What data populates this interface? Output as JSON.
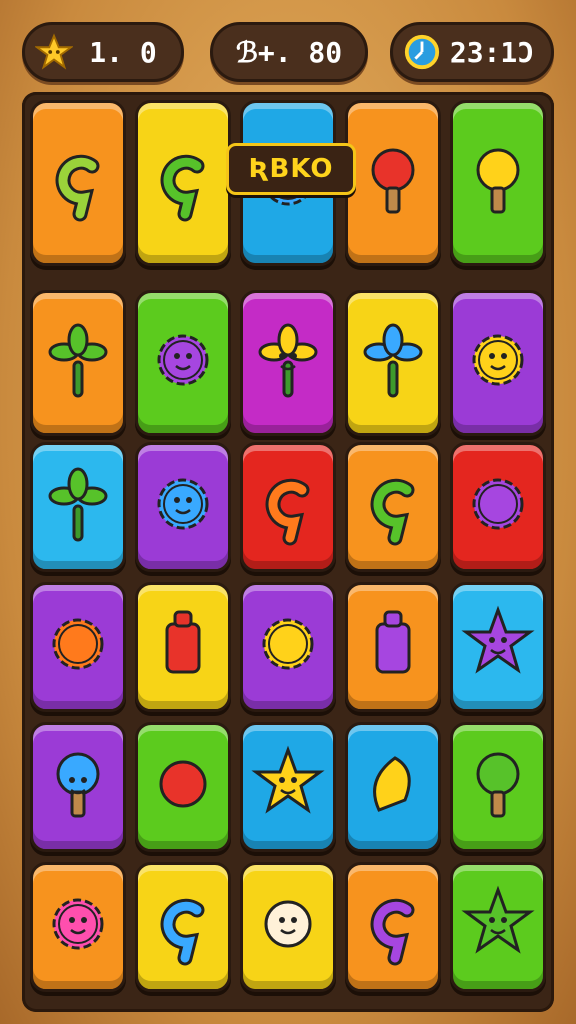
{
  "hud": {
    "level": {
      "icon": "star-icon",
      "text": "1. 0"
    },
    "score": {
      "text": "ℬ+. 80"
    },
    "timer": {
      "icon": "clock-icon",
      "text": "23:1Ͻ"
    }
  },
  "banner": {
    "text": "ƦBKO"
  },
  "colors": {
    "orange": "#f7931e",
    "yellow": "#f7d417",
    "blue": "#1fa8e6",
    "green": "#5ccb1e",
    "purple": "#9b3bd6",
    "magenta": "#c42bc6",
    "red": "#e4261f",
    "lightblue": "#2cb8ee"
  },
  "board": {
    "rows": [
      [
        {
          "color": "orange",
          "icon": "swirl-sprout-icon"
        },
        {
          "color": "yellow",
          "icon": "green-crescent-icon"
        },
        {
          "color": "blue",
          "icon": "blue-spiky-creature-icon"
        },
        {
          "color": "orange",
          "icon": "red-bulb-ice-cream-icon"
        },
        {
          "color": "green",
          "icon": "yellow-bulb-icon"
        }
      ],
      [
        {
          "color": "orange",
          "icon": "green-palm-icon"
        },
        {
          "color": "green",
          "icon": "purple-flower-face-icon"
        },
        {
          "color": "magenta",
          "icon": "yellow-leaf-creature-icon"
        },
        {
          "color": "yellow",
          "icon": "blue-palm-icon"
        },
        {
          "color": "purple",
          "icon": "yellow-sun-face-icon"
        }
      ],
      [
        {
          "color": "lightblue",
          "icon": "green-sprout-icon"
        },
        {
          "color": "purple",
          "icon": "blue-germ-icon"
        },
        {
          "color": "red",
          "icon": "orange-spiral-icon"
        },
        {
          "color": "orange",
          "icon": "green-spiral-icon"
        },
        {
          "color": "red",
          "icon": "purple-flower-icon"
        }
      ],
      [
        {
          "color": "purple",
          "icon": "orange-gear-icon"
        },
        {
          "color": "yellow",
          "icon": "red-bottle-icon"
        },
        {
          "color": "purple",
          "icon": "yellow-flower-icon"
        },
        {
          "color": "orange",
          "icon": "purple-box-icon"
        },
        {
          "color": "lightblue",
          "icon": "purple-star-face-icon"
        }
      ],
      [
        {
          "color": "purple",
          "icon": "blue-cone-face-icon"
        },
        {
          "color": "green",
          "icon": "red-berry-icon"
        },
        {
          "color": "blue",
          "icon": "yellow-star-face-icon"
        },
        {
          "color": "blue",
          "icon": "yellow-pepper-icon"
        },
        {
          "color": "green",
          "icon": "green-bulb-icon"
        }
      ],
      [
        {
          "color": "orange",
          "icon": "pink-spiky-face-icon"
        },
        {
          "color": "yellow",
          "icon": "blue-swirl-icon"
        },
        {
          "color": "yellow",
          "icon": "cream-creature-icon"
        },
        {
          "color": "orange",
          "icon": "purple-spiral-icon"
        },
        {
          "color": "green",
          "icon": "green-star-face-icon"
        }
      ]
    ]
  }
}
